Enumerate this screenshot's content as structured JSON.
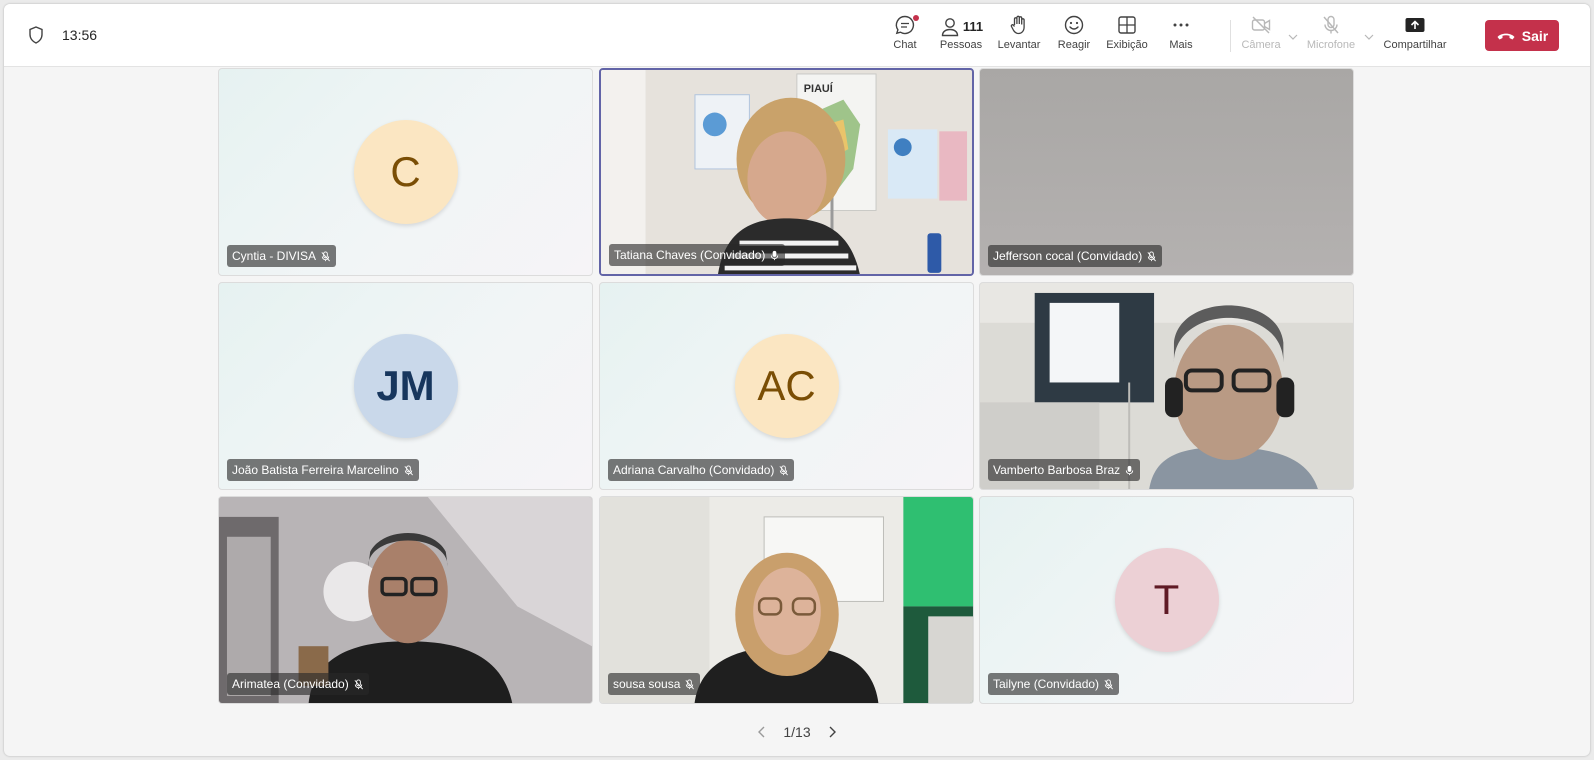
{
  "header": {
    "time": "13:56",
    "chat_label": "Chat",
    "people_label": "Pessoas",
    "people_count": "111",
    "raise_label": "Levantar",
    "react_label": "Reagir",
    "view_label": "Exibição",
    "more_label": "Mais",
    "camera_label": "Câmera",
    "mic_label": "Microfone",
    "share_label": "Compartilhar",
    "leave_label": "Sair"
  },
  "participants": [
    {
      "name": "Cyntia - DIVISA",
      "initials": "C"
    },
    {
      "name": "Tatiana Chaves (Convidado)"
    },
    {
      "name": "Jefferson cocal (Convidado)"
    },
    {
      "name": "João Batista Ferreira Marcelino",
      "initials": "JM"
    },
    {
      "name": "Adriana Carvalho (Convidado)",
      "initials": "AC"
    },
    {
      "name": "Vamberto Barbosa Braz"
    },
    {
      "name": "Arimatea (Convidado)"
    },
    {
      "name": "sousa sousa"
    },
    {
      "name": "Tailyne (Convidado)",
      "initials": "T"
    }
  ],
  "video_text": {
    "map_title": "PIAUÍ"
  },
  "pager": {
    "label": "1/13"
  },
  "colors": {
    "accent": "#6264a7",
    "leave": "#c4314b"
  }
}
